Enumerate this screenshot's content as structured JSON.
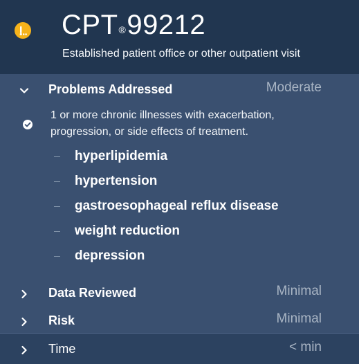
{
  "header": {
    "code_prefix": "CPT",
    "code_reg_mark": "®",
    "code_number": "99212",
    "description": "Established patient office or other outpatient visit",
    "status_icon": "in-progress-dots-icon",
    "status_color": "#f6b31b"
  },
  "sections": {
    "problems": {
      "label": "Problems Addressed",
      "level": "Moderate",
      "expanded": true,
      "criterion": "1 or more chronic illnesses with exacerbation, progression, or side effects of treatment.",
      "criterion_met": true,
      "diagnoses": [
        "hyperlipidemia",
        "hypertension",
        "gastroesophageal reflux disease",
        "weight reduction",
        "depression"
      ]
    },
    "data": {
      "label": "Data Reviewed",
      "level": "Minimal",
      "expanded": false
    },
    "risk": {
      "label": "Risk",
      "level": "Minimal",
      "expanded": false
    },
    "time": {
      "label": "Time",
      "level": "< min",
      "expanded": false
    }
  },
  "colors": {
    "header_bg": "#213650",
    "panel_bg": "#3a5070",
    "time_row_bg": "#2c4260",
    "muted_text": "#a9b5c4"
  }
}
